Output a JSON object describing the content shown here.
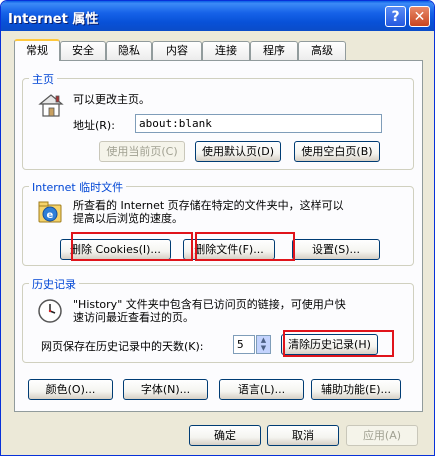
{
  "window": {
    "title": "Internet 属性"
  },
  "titlebar": {
    "help_label": "?",
    "close_label": "✕"
  },
  "tabs": [
    {
      "label": "常规",
      "active": true
    },
    {
      "label": "安全"
    },
    {
      "label": "隐私"
    },
    {
      "label": "内容"
    },
    {
      "label": "连接"
    },
    {
      "label": "程序"
    },
    {
      "label": "高级"
    }
  ],
  "homepage": {
    "title": "主页",
    "description": "可以更改主页。",
    "address_label": "地址(R):",
    "address_value": "about:blank",
    "use_current_label": "使用当前页(C)",
    "use_default_label": "使用默认页(D)",
    "use_blank_label": "使用空白页(B)"
  },
  "temp_files": {
    "title": "Internet 临时文件",
    "description_line1": "所查看的 Internet 页存储在特定的文件夹中，这样可以",
    "description_line2": "提高以后浏览的速度。",
    "delete_cookies_label": "删除 Cookies(I)...",
    "delete_files_label": "删除文件(F)...",
    "settings_label": "设置(S)..."
  },
  "history": {
    "title": "历史记录",
    "description_line1": "\"History\" 文件夹中包含有已访问页的链接，可使用户快",
    "description_line2": "速访问最近查看过的页。",
    "days_label": "网页保存在历史记录中的天数(K):",
    "days_value": "5",
    "clear_label": "清除历史记录(H)"
  },
  "bottom_buttons": {
    "colors_label": "颜色(O)...",
    "fonts_label": "字体(N)...",
    "languages_label": "语言(L)...",
    "accessibility_label": "辅助功能(E)..."
  },
  "dialog_buttons": {
    "ok_label": "确定",
    "cancel_label": "取消",
    "apply_label": "应用(A)"
  },
  "colors": {
    "highlight": "#e0141b",
    "titlebar": "#0a5fe6",
    "group_title": "#0046d5"
  }
}
